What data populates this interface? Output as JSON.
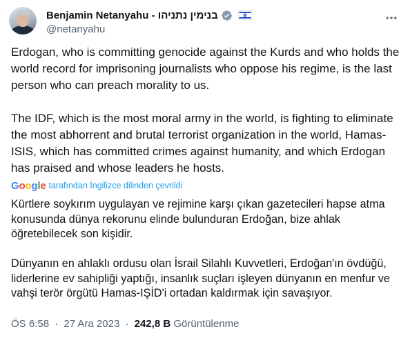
{
  "author": {
    "display_name": "Benjamin Netanyahu - בנימין נתניהו",
    "handle": "@netanyahu"
  },
  "icons": {
    "verified": "verified-badge-icon",
    "flag": "israel-flag-icon",
    "more": "more-options-icon"
  },
  "colors": {
    "verified_gray": "#829aab",
    "link_blue": "#1d9bf0",
    "secondary_text": "#536471",
    "flag_blue": "#0038b8"
  },
  "tweet": {
    "paragraphs": [
      "Erdogan, who is committing genocide against the Kurds and who holds the world record for imprisoning journalists who oppose his regime, is the last person who can preach morality to us.",
      "The IDF, which is the most moral army in the world, is fighting to eliminate the most abhorrent and brutal terrorist organization in the world, Hamas-ISIS, which has committed crimes against humanity, and which Erdogan has praised and whose leaders he hosts."
    ]
  },
  "translation": {
    "provider": "Google",
    "label": "tarafından İngilizce dilinden çevrildi",
    "paragraphs": [
      "Kürtlere soykırım uygulayan ve rejimine karşı çıkan gazetecileri hapse atma konusunda dünya rekorunu elinde bulunduran Erdoğan, bize ahlak öğretebilecek son kişidir.",
      "Dünyanın en ahlaklı ordusu olan İsrail Silahlı Kuvvetleri, Erdoğan'ın övdüğü, liderlerine ev sahipliği yaptığı, insanlık suçları işleyen dünyanın en menfur ve vahşi terör örgütü Hamas-IŞİD'i ortadan kaldırmak için savaşıyor."
    ]
  },
  "meta": {
    "time": "ÖS 6:58",
    "separator": "·",
    "date": "27 Ara 2023",
    "views_count": "242,8 B",
    "views_label": "Görüntülenme"
  }
}
